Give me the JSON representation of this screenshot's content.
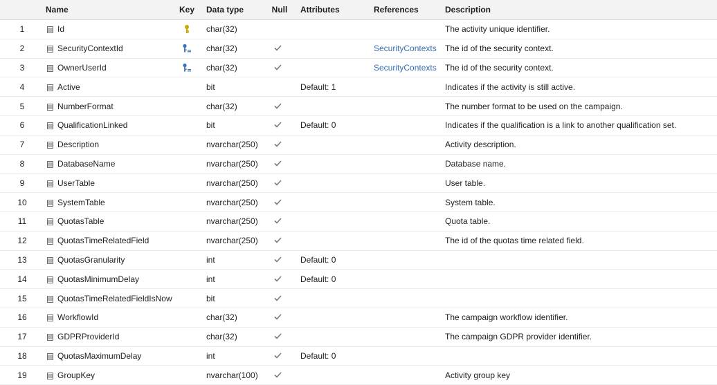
{
  "header": {
    "name": "Name",
    "key": "Key",
    "data_type": "Data type",
    "null": "Null",
    "attributes": "Attributes",
    "references": "References",
    "description": "Description"
  },
  "colors": {
    "primary_key": "#c8a800",
    "foreign_key": "#3a6fb0",
    "reference_link": "#3a6fb0"
  },
  "rows": [
    {
      "num": "1",
      "name": "Id",
      "key": "primary-key-icon",
      "type": "char(32)",
      "null": false,
      "attr": "",
      "ref": "",
      "desc": "The activity unique identifier."
    },
    {
      "num": "2",
      "name": "SecurityContextId",
      "key": "foreign-key-icon",
      "type": "char(32)",
      "null": true,
      "attr": "",
      "ref": "SecurityContexts",
      "desc": "The id of the security context."
    },
    {
      "num": "3",
      "name": "OwnerUserId",
      "key": "foreign-key-icon",
      "type": "char(32)",
      "null": true,
      "attr": "",
      "ref": "SecurityContexts",
      "desc": "The id of the security context."
    },
    {
      "num": "4",
      "name": "Active",
      "key": "",
      "type": "bit",
      "null": false,
      "attr": "Default: 1",
      "ref": "",
      "desc": "Indicates if the activity is still active."
    },
    {
      "num": "5",
      "name": "NumberFormat",
      "key": "",
      "type": "char(32)",
      "null": true,
      "attr": "",
      "ref": "",
      "desc": "The number format to be used on the campaign."
    },
    {
      "num": "6",
      "name": "QualificationLinked",
      "key": "",
      "type": "bit",
      "null": true,
      "attr": "Default: 0",
      "ref": "",
      "desc": "Indicates if the qualification is a link to another qualification set."
    },
    {
      "num": "7",
      "name": "Description",
      "key": "",
      "type": "nvarchar(250)",
      "null": true,
      "attr": "",
      "ref": "",
      "desc": "Activity description."
    },
    {
      "num": "8",
      "name": "DatabaseName",
      "key": "",
      "type": "nvarchar(250)",
      "null": true,
      "attr": "",
      "ref": "",
      "desc": "Database name."
    },
    {
      "num": "9",
      "name": "UserTable",
      "key": "",
      "type": "nvarchar(250)",
      "null": true,
      "attr": "",
      "ref": "",
      "desc": "User table."
    },
    {
      "num": "10",
      "name": "SystemTable",
      "key": "",
      "type": "nvarchar(250)",
      "null": true,
      "attr": "",
      "ref": "",
      "desc": "System table."
    },
    {
      "num": "11",
      "name": "QuotasTable",
      "key": "",
      "type": "nvarchar(250)",
      "null": true,
      "attr": "",
      "ref": "",
      "desc": "Quota table."
    },
    {
      "num": "12",
      "name": "QuotasTimeRelatedField",
      "key": "",
      "type": "nvarchar(250)",
      "null": true,
      "attr": "",
      "ref": "",
      "desc": "The id of the quotas time related field."
    },
    {
      "num": "13",
      "name": "QuotasGranularity",
      "key": "",
      "type": "int",
      "null": true,
      "attr": "Default: 0",
      "ref": "",
      "desc": ""
    },
    {
      "num": "14",
      "name": "QuotasMinimumDelay",
      "key": "",
      "type": "int",
      "null": true,
      "attr": "Default: 0",
      "ref": "",
      "desc": ""
    },
    {
      "num": "15",
      "name": "QuotasTimeRelatedFieldIsNow",
      "key": "",
      "type": "bit",
      "null": true,
      "attr": "",
      "ref": "",
      "desc": ""
    },
    {
      "num": "16",
      "name": "WorkflowId",
      "key": "",
      "type": "char(32)",
      "null": true,
      "attr": "",
      "ref": "",
      "desc": "The campaign workflow identifier."
    },
    {
      "num": "17",
      "name": "GDPRProviderId",
      "key": "",
      "type": "char(32)",
      "null": true,
      "attr": "",
      "ref": "",
      "desc": "The campaign GDPR provider identifier."
    },
    {
      "num": "18",
      "name": "QuotasMaximumDelay",
      "key": "",
      "type": "int",
      "null": true,
      "attr": "Default: 0",
      "ref": "",
      "desc": ""
    },
    {
      "num": "19",
      "name": "GroupKey",
      "key": "",
      "type": "nvarchar(100)",
      "null": true,
      "attr": "",
      "ref": "",
      "desc": "Activity group key"
    }
  ]
}
